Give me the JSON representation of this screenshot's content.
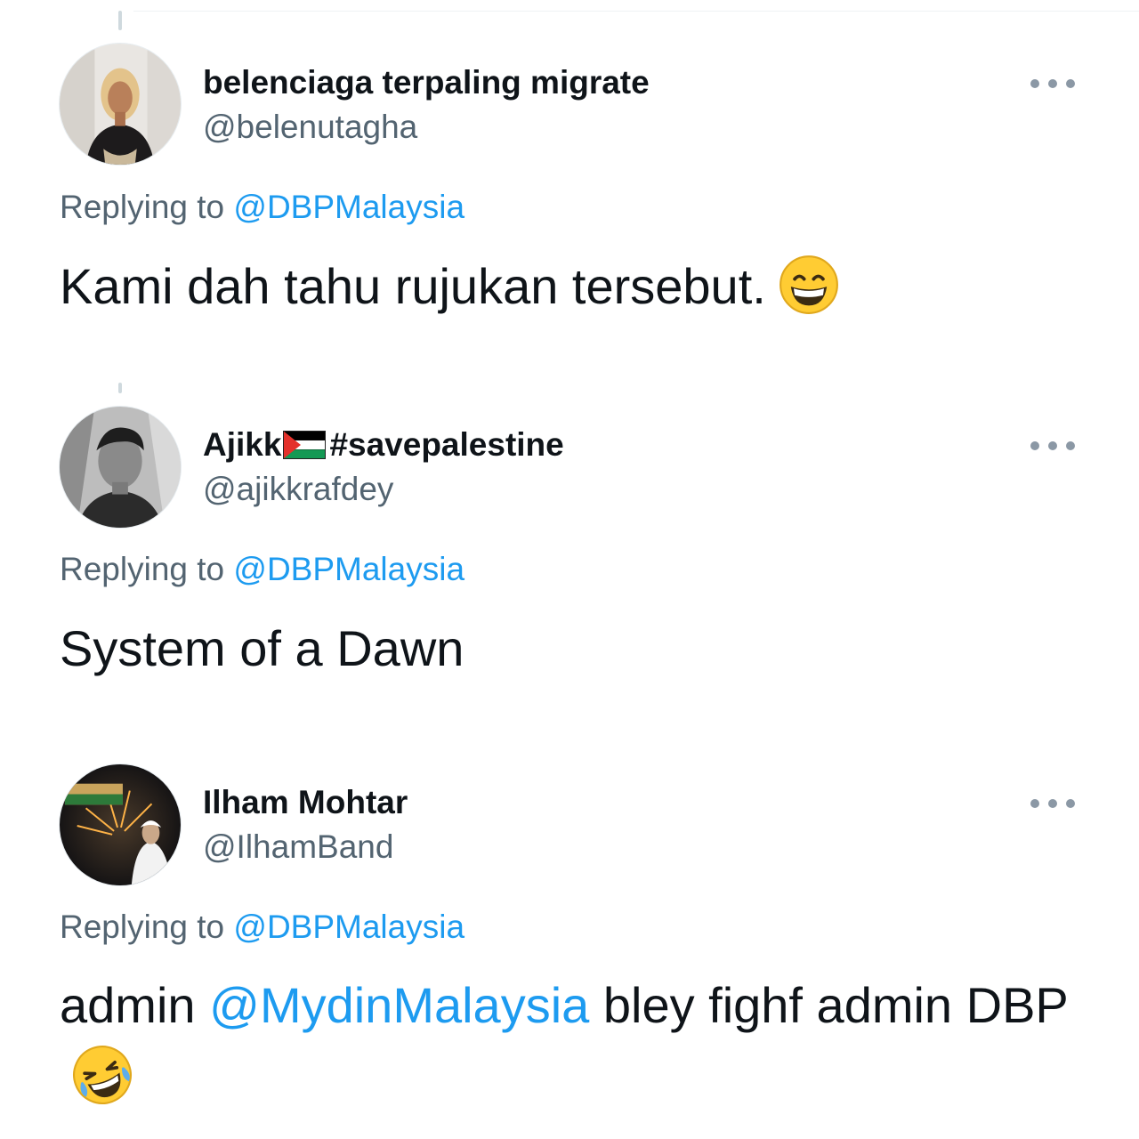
{
  "tweets": [
    {
      "display_name": "belenciaga terpaling migrate",
      "handle": "@belenutagha",
      "replying_prefix": "Replying to ",
      "replying_to": "@DBPMalaysia",
      "text": "Kami dah tahu rujukan tersebut.",
      "emoji": "grinning-face-with-smiling-eyes"
    },
    {
      "display_name": "Ajikk",
      "display_name_suffix": "#savepalestine",
      "flag": "palestine-flag",
      "handle": "@ajikkrafdey",
      "replying_prefix": "Replying to ",
      "replying_to": "@DBPMalaysia",
      "text": "System of a Dawn"
    },
    {
      "display_name": "Ilham Mohtar",
      "handle": "@IlhamBand",
      "replying_prefix": "Replying to ",
      "replying_to": "@DBPMalaysia",
      "text_pre": "admin ",
      "text_mention": "@MydinMalaysia",
      "text_post": " bley fighf admin DBP",
      "emoji": "rolling-on-the-floor-laughing"
    }
  ],
  "colors": {
    "text": "#0f1419",
    "secondary": "#536471",
    "link": "#1d9bf0",
    "more_dots": "#8b98a5",
    "thread_line": "#cfd9de"
  }
}
